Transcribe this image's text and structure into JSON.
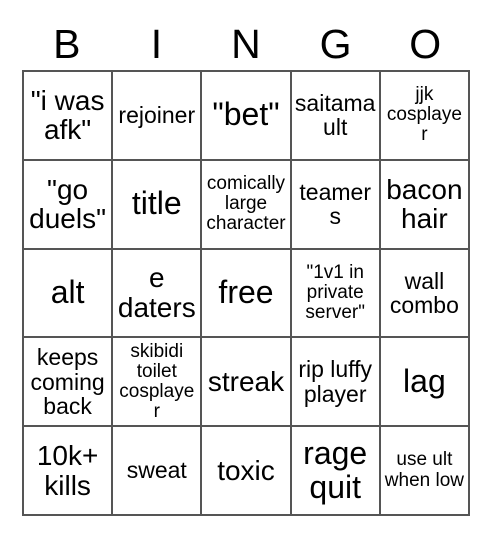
{
  "card": {
    "title": "BINGO",
    "header_letters": [
      "B",
      "I",
      "N",
      "G",
      "O"
    ],
    "grid_size": 5,
    "border_color": "#555555",
    "text_color": "#000000",
    "background_color": "#ffffff",
    "free_space": "free",
    "rows": [
      [
        {
          "text": "\"i was afk\"",
          "size": "lg"
        },
        {
          "text": "rejoiner",
          "size": "md"
        },
        {
          "text": "\"bet\"",
          "size": "xl"
        },
        {
          "text": "saitama ult",
          "size": "md"
        },
        {
          "text": "jjk cosplayer",
          "size": "sm"
        }
      ],
      [
        {
          "text": "\"go duels\"",
          "size": "lg"
        },
        {
          "text": "title",
          "size": "xl"
        },
        {
          "text": "comically large character",
          "size": "sm"
        },
        {
          "text": "teamers",
          "size": "md"
        },
        {
          "text": "bacon hair",
          "size": "lg"
        }
      ],
      [
        {
          "text": "alt",
          "size": "xl"
        },
        {
          "text": "e daters",
          "size": "lg"
        },
        {
          "text": "free",
          "size": "xl"
        },
        {
          "text": "\"1v1 in private server\"",
          "size": "sm"
        },
        {
          "text": "wall combo",
          "size": "md"
        }
      ],
      [
        {
          "text": "keeps coming back",
          "size": "md"
        },
        {
          "text": "skibidi toilet cosplayer",
          "size": "sm"
        },
        {
          "text": "streak",
          "size": "lg"
        },
        {
          "text": "rip luffy player",
          "size": "md"
        },
        {
          "text": "lag",
          "size": "xl"
        }
      ],
      [
        {
          "text": "10k+ kills",
          "size": "lg"
        },
        {
          "text": "sweat",
          "size": "md"
        },
        {
          "text": "toxic",
          "size": "lg"
        },
        {
          "text": "rage quit",
          "size": "xl"
        },
        {
          "text": "use ult when low",
          "size": "sm"
        }
      ]
    ]
  }
}
